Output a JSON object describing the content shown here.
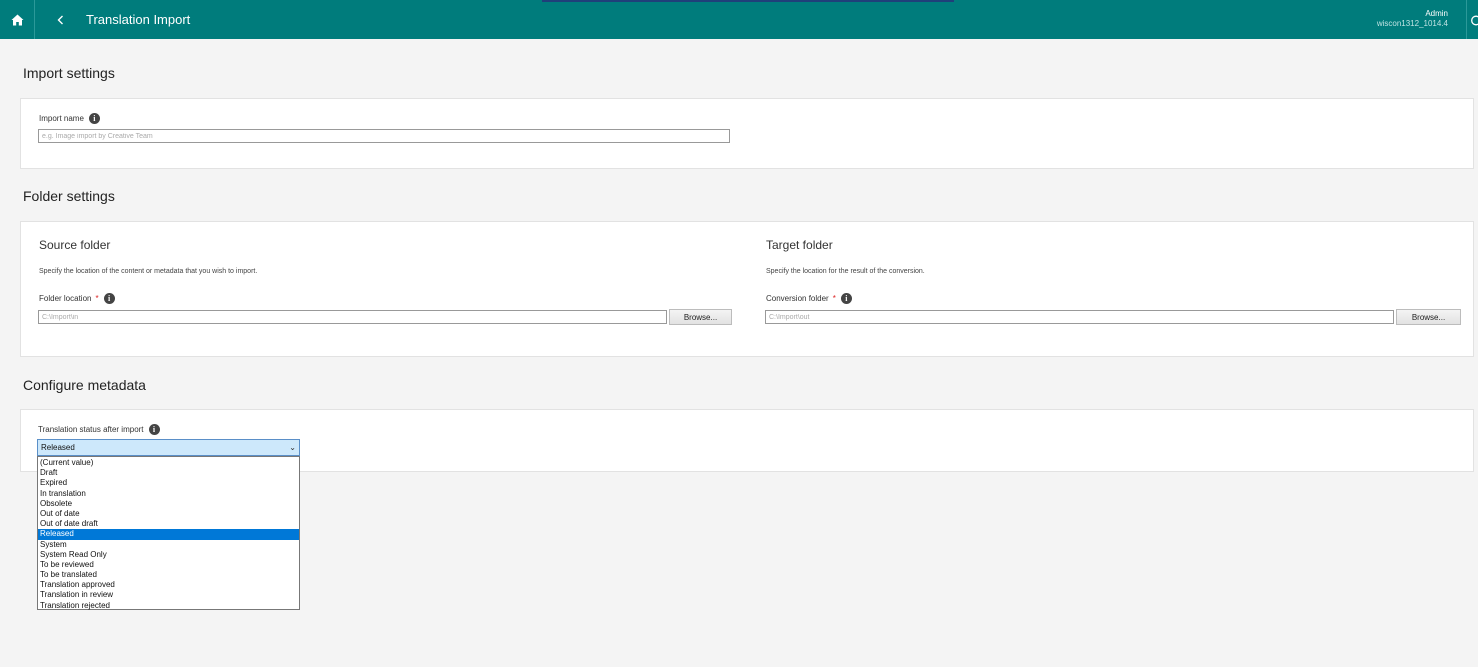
{
  "header": {
    "title": "Translation Import",
    "user_name": "Admin",
    "server": "wiscon1312_1014.4",
    "icons": {
      "home": "home-icon",
      "back": "chevron-left-icon",
      "power": "power-icon"
    }
  },
  "import_settings": {
    "section_title": "Import settings",
    "import_name_label": "Import name",
    "import_name_placeholder": "e.g. Image import by Creative Team"
  },
  "folder_settings": {
    "section_title": "Folder settings",
    "source": {
      "title": "Source folder",
      "description": "Specify the location of the content or metadata that you wish to import.",
      "field_label": "Folder location",
      "required_marker": "*",
      "placeholder": "C:\\Import\\in",
      "browse_label": "Browse..."
    },
    "target": {
      "title": "Target folder",
      "description": "Specify the location for the result of the conversion.",
      "field_label": "Conversion folder",
      "required_marker": "*",
      "placeholder": "C:\\Import\\out",
      "browse_label": "Browse..."
    }
  },
  "configure_metadata": {
    "section_title": "Configure metadata",
    "status_label": "Translation status after import",
    "selected_value": "Released",
    "options": [
      "(Current value)",
      "Draft",
      "Expired",
      "In translation",
      "Obsolete",
      "Out of date",
      "Out of date draft",
      "Released",
      "System",
      "System Read Only",
      "To be reviewed",
      "To be translated",
      "Translation approved",
      "Translation in review",
      "Translation rejected"
    ]
  },
  "colors": {
    "header_bg": "#007c7c",
    "selected_option_bg": "#0078d7",
    "required_marker": "#d22222"
  }
}
